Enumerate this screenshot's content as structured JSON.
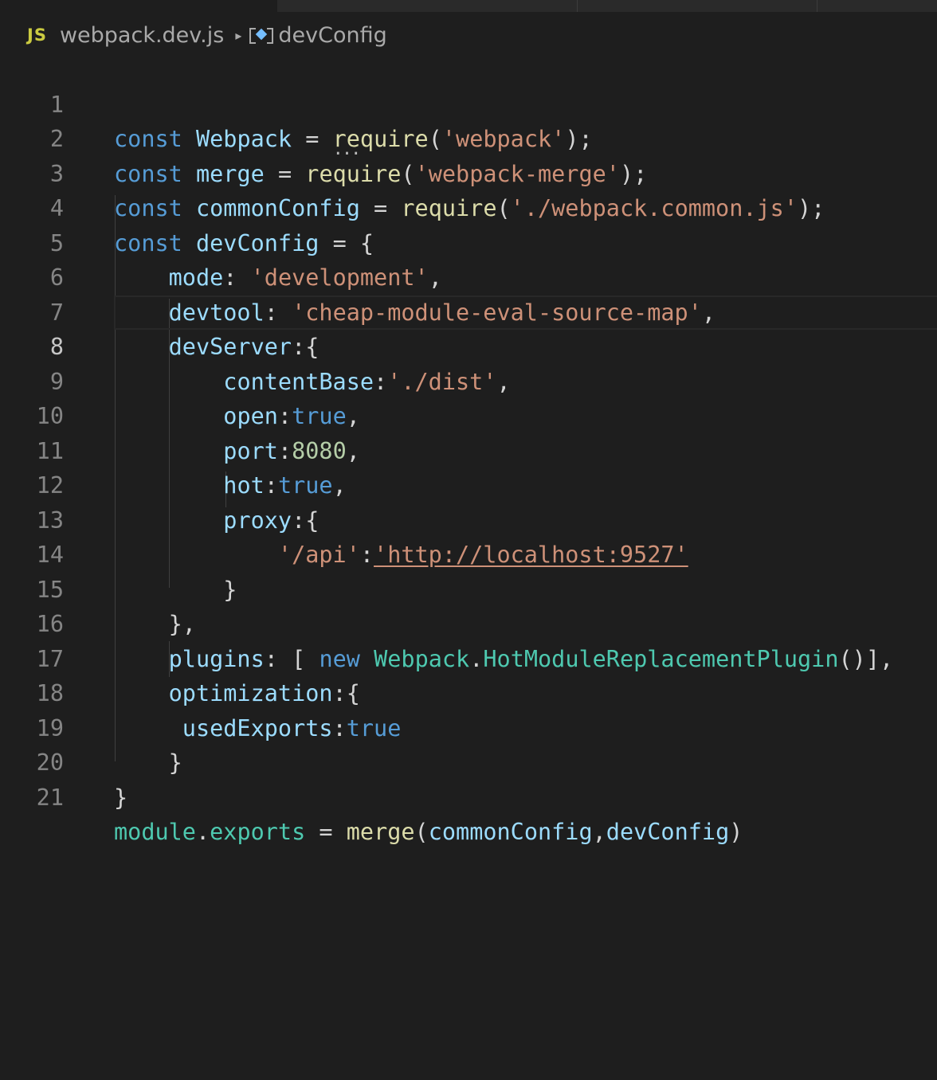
{
  "tabs": {},
  "breadcrumb": {
    "file_icon": "JS",
    "file_name": "webpack.dev.js",
    "chevron": "▸",
    "symbol_icon": "symbol-variable-icon",
    "symbol_name": "devConfig"
  },
  "editor": {
    "active_line": 8,
    "line_numbers": [
      "1",
      "2",
      "3",
      "4",
      "5",
      "6",
      "7",
      "8",
      "9",
      "10",
      "11",
      "12",
      "13",
      "14",
      "15",
      "16",
      "17",
      "18",
      "19",
      "20",
      "21"
    ],
    "lines": [
      "const Webpack = require('webpack');",
      "const merge = require('webpack-merge');",
      "const commonConfig = require('./webpack.common.js');",
      "const devConfig = {",
      "    mode: 'development',",
      "    devtool: 'cheap-module-eval-source-map',",
      "    devServer:{",
      "        contentBase:'./dist',",
      "        open:true,",
      "        port:8080,",
      "        hot:true,",
      "        proxy:{",
      "            '/api':'http://localhost:9527'",
      "        }",
      "    },",
      "    plugins: [ new Webpack.HotModuleReplacementPlugin()],",
      "    optimization:{",
      "     usedExports:true",
      "    }",
      "}",
      "module.exports = merge(commonConfig,devConfig)"
    ]
  }
}
